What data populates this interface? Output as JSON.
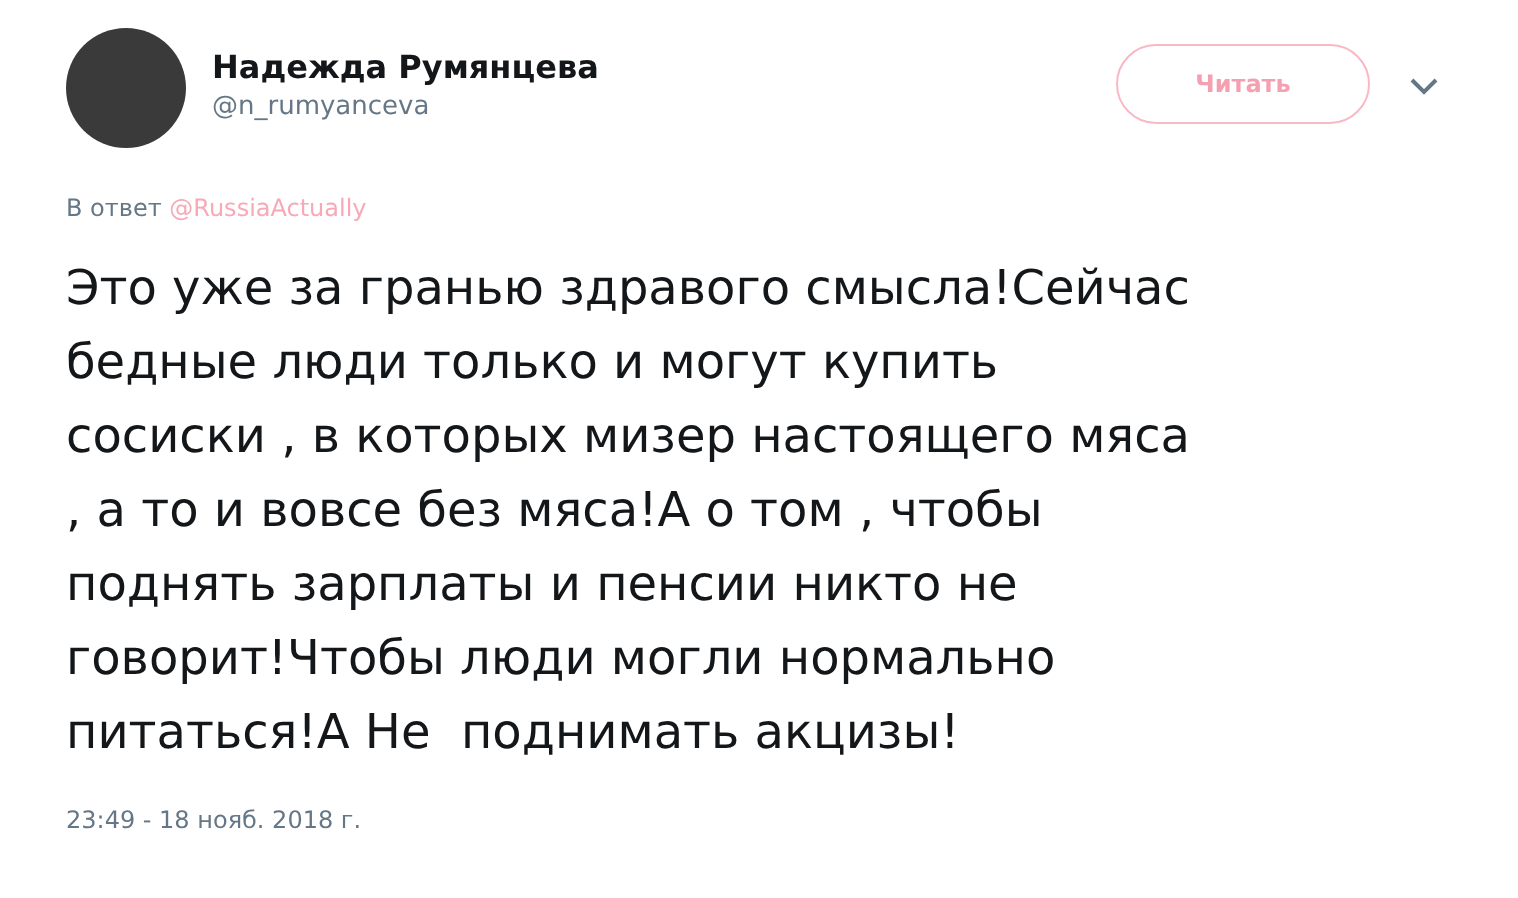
{
  "author": {
    "name": "Надежда Румянцева",
    "handle": "@n_rumyanceva"
  },
  "follow_button": {
    "label": "Читать"
  },
  "reply": {
    "prefix": "В ответ",
    "mention": "@RussiaActually"
  },
  "tweet_lines": [
    "Это уже за гранью здравого смысла!Сейчас",
    "бедные люди только и могут купить",
    "сосиски , в которых мизер настоящего мяса",
    ", а то и вовсе без мяса!А о том , чтобы",
    "поднять зарплаты и пенсии никто не",
    "говорит!Чтобы люди могли нормально",
    "питаться!А Не  поднимать акцизы!"
  ],
  "timestamp": "23:49 - 18 нояб. 2018 г."
}
